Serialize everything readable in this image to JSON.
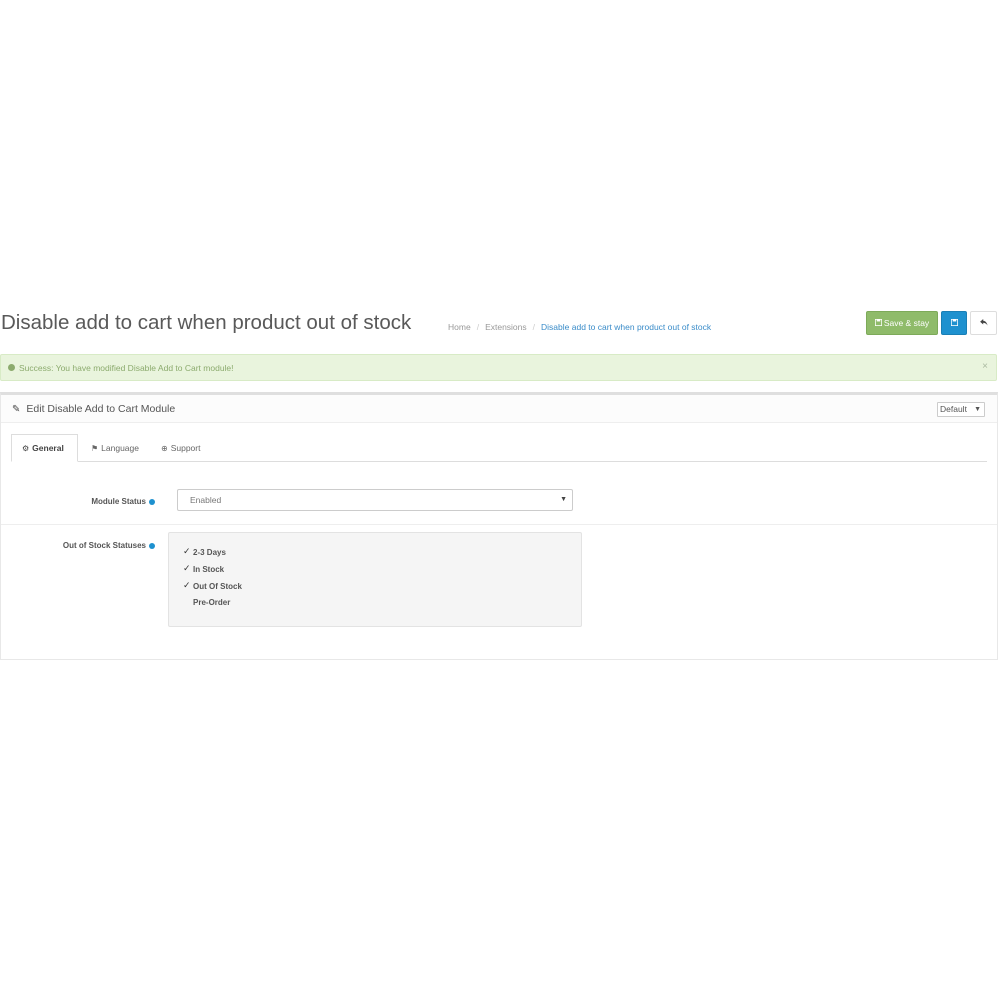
{
  "header": {
    "title": "Disable add to cart when product out of stock",
    "breadcrumb": [
      {
        "label": "Home"
      },
      {
        "label": "Extensions"
      },
      {
        "label": "Disable add to cart when product out of stock"
      }
    ],
    "save_stay_label": "Save & stay",
    "save_icon": "save-icon",
    "back_icon": "reply-icon"
  },
  "alert": {
    "message": "Success: You have modified Disable Add to Cart module!",
    "close_label": "×"
  },
  "panel": {
    "title": "Edit Disable Add to Cart Module",
    "store_select": "Default"
  },
  "tabs": [
    {
      "label": "General",
      "active": true
    },
    {
      "label": "Language",
      "active": false
    },
    {
      "label": "Support",
      "active": false
    }
  ],
  "form": {
    "module_status_label": "Module Status",
    "module_status_value": "Enabled",
    "out_of_stock_label": "Out of Stock Statuses",
    "statuses": [
      {
        "label": "2-3 Days",
        "checked": true
      },
      {
        "label": "In Stock",
        "checked": true
      },
      {
        "label": "Out Of Stock",
        "checked": true
      },
      {
        "label": "Pre-Order",
        "checked": false
      }
    ]
  },
  "colors": {
    "primary": "#1e91cf",
    "success": "#8fbb6a",
    "alert_bg": "#e9f4dd"
  }
}
